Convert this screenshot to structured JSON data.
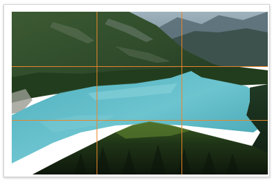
{
  "image": {
    "subject": "mountain-lake-landscape",
    "overlay": "rule-of-thirds-grid"
  },
  "colors": {
    "grid_line": "#e8862a",
    "lake": "#57b7c3",
    "forest_dark": "#12200f",
    "forest_mid": "#2b4a22",
    "mountain": "#3a4d44",
    "sky": "#7f98a6",
    "frame_border": "#d4d4d4"
  }
}
